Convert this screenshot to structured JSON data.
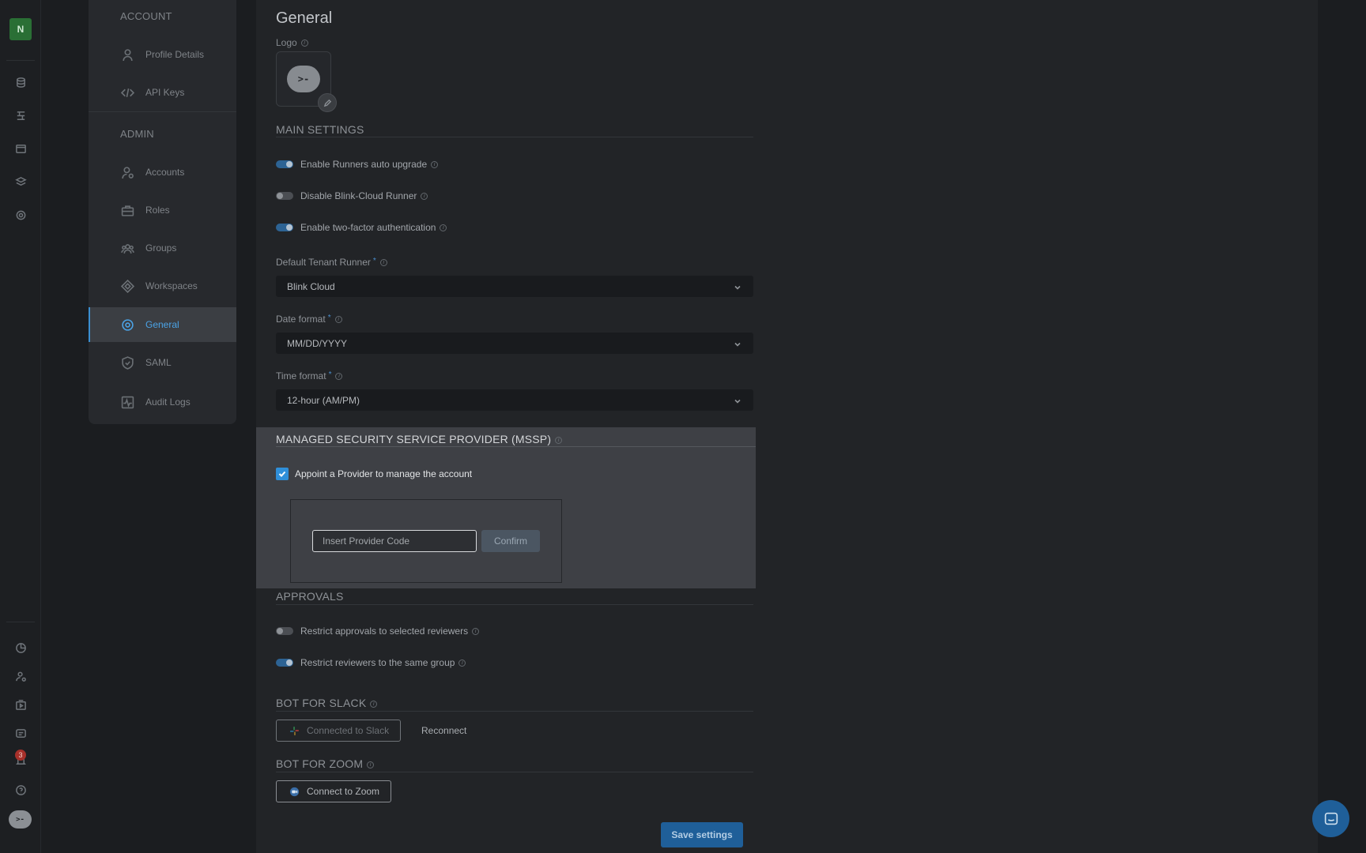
{
  "rail": {
    "avatar_letter": "N",
    "notification_count": "3",
    "logo_text": ">-"
  },
  "nav": {
    "account_heading": "ACCOUNT",
    "admin_heading": "ADMIN",
    "items": [
      {
        "label": "Profile Details",
        "icon": "user-icon"
      },
      {
        "label": "API Keys",
        "icon": "code-icon"
      },
      {
        "label": "Accounts",
        "icon": "user-gear-icon"
      },
      {
        "label": "Roles",
        "icon": "briefcase-icon"
      },
      {
        "label": "Groups",
        "icon": "group-icon"
      },
      {
        "label": "Workspaces",
        "icon": "diamond-icon"
      },
      {
        "label": "General",
        "icon": "gear-icon",
        "active": true
      },
      {
        "label": "SAML",
        "icon": "shield-icon"
      },
      {
        "label": "Audit Logs",
        "icon": "activity-icon"
      }
    ]
  },
  "main": {
    "title": "General",
    "logo_label": "Logo",
    "logo_text": ">-",
    "main_settings": {
      "heading": "MAIN SETTINGS",
      "toggles": [
        {
          "label": "Enable Runners auto upgrade",
          "on": true
        },
        {
          "label": "Disable Blink-Cloud Runner",
          "on": false
        },
        {
          "label": "Enable two-factor authentication",
          "on": true
        }
      ]
    },
    "default_runner": {
      "label": "Default Tenant Runner",
      "value": "Blink Cloud"
    },
    "date_format": {
      "label": "Date format",
      "value": "MM/DD/YYYY"
    },
    "time_format": {
      "label": "Time format",
      "value": "12-hour (AM/PM)"
    },
    "mssp": {
      "heading": "MANAGED SECURITY SERVICE PROVIDER (MSSP)",
      "checkbox_label": "Appoint a Provider to manage the account",
      "checked": true,
      "input_placeholder": "Insert Provider Code",
      "confirm_label": "Confirm"
    },
    "approvals": {
      "heading": "APPROVALS",
      "toggles": [
        {
          "label": "Restrict approvals to selected reviewers",
          "on": false
        },
        {
          "label": "Restrict reviewers to the same group",
          "on": true
        }
      ]
    },
    "slack": {
      "heading": "BOT FOR SLACK",
      "connected_label": "Connected to Slack",
      "reconnect_label": "Reconnect"
    },
    "zoom": {
      "heading": "BOT FOR ZOOM",
      "connect_label": "Connect to Zoom"
    },
    "save_label": "Save settings",
    "required_mark": "*",
    "info_mark": "i"
  },
  "colors": {
    "accent": "#2f8fd9",
    "save_button": "#1f5f99",
    "active_nav_text": "#4ba3e6"
  }
}
